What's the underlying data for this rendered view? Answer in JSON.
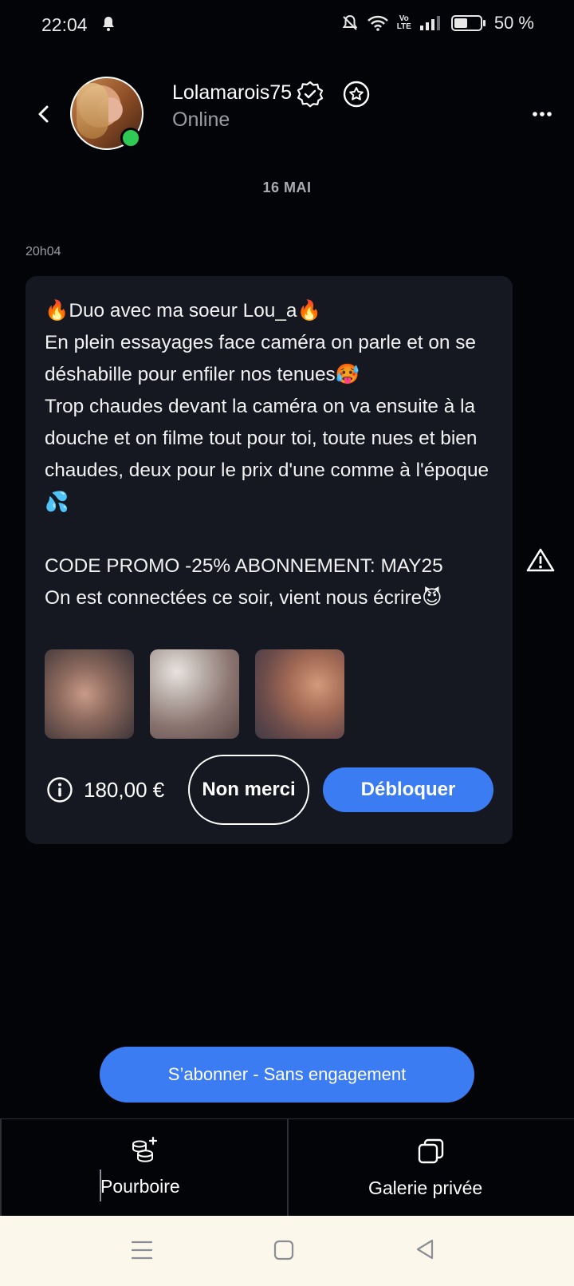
{
  "status_bar": {
    "time": "22:04",
    "battery_text": "50 %",
    "network_badge_top": "Vo",
    "network_badge_bottom": "LTE",
    "icons": [
      "bell-icon",
      "mute-icon",
      "wifi-icon",
      "signal-icon",
      "battery-icon"
    ],
    "battery_level": 0.5
  },
  "header": {
    "username": "Lolamarois75",
    "presence": "Online",
    "online": true,
    "icons": [
      "back-icon",
      "verified-icon",
      "star-icon",
      "more-icon"
    ]
  },
  "chat": {
    "date_separator": "16 MAI",
    "message": {
      "time": "20h04",
      "text": "🔥Duo avec ma soeur Lou_a🔥\nEn plein essayages face caméra on parle et on se déshabille pour enfiler nos tenues🥵\nTrop chaudes devant la caméra on va ensuite à la douche et on filme tout pour toi, toute nues et bien chaudes, deux pour le prix d'une comme à l'époque💦\n\nCODE PROMO -25% ABONNEMENT: MAY25\nOn est connectées ce soir, vient nous écrire😈",
      "locked_media_count": 3,
      "price": "180,00 €",
      "decline_label": "Non merci",
      "unlock_label": "Débloquer"
    }
  },
  "subscribe": {
    "label": "S’abonner - Sans engagement"
  },
  "tabs": [
    {
      "label": "Pourboire",
      "icon": "tip-coins-icon"
    },
    {
      "label": "Galerie privée",
      "icon": "gallery-icon"
    }
  ],
  "colors": {
    "background": "#030407",
    "bubble": "#151821",
    "accent": "#3b7cf3",
    "online": "#2fca54",
    "navbar": "#fbf7ea"
  }
}
